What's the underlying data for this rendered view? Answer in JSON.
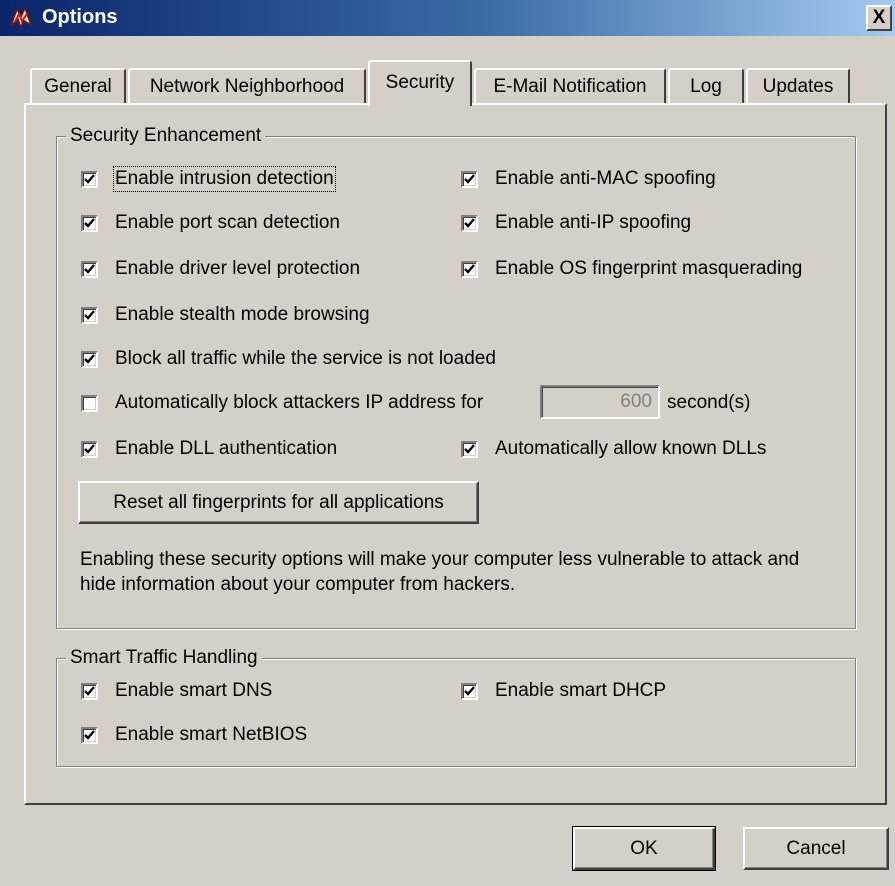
{
  "window": {
    "title": "Options",
    "close_label": "X"
  },
  "tabs": [
    {
      "label": "General"
    },
    {
      "label": "Network Neighborhood"
    },
    {
      "label": "Security",
      "active": true
    },
    {
      "label": "E-Mail Notification"
    },
    {
      "label": "Log"
    },
    {
      "label": "Updates"
    }
  ],
  "security_enhancement": {
    "title": "Security Enhancement",
    "options": [
      {
        "label": "Enable intrusion detection",
        "checked": true
      },
      {
        "label": "Enable anti-MAC spoofing",
        "checked": true
      },
      {
        "label": "Enable port scan detection",
        "checked": true
      },
      {
        "label": "Enable anti-IP spoofing",
        "checked": true
      },
      {
        "label": "Enable driver level protection",
        "checked": true
      },
      {
        "label": "Enable OS fingerprint masquerading",
        "checked": true
      },
      {
        "label": "Enable stealth mode browsing",
        "checked": true
      },
      {
        "label": "Block all traffic while the service is not loaded",
        "checked": true
      },
      {
        "label": "Automatically block attackers IP address for",
        "checked": false
      },
      {
        "label": "Enable DLL authentication",
        "checked": true
      },
      {
        "label": "Automatically allow known DLLs",
        "checked": true
      }
    ],
    "block_seconds": {
      "value": "600",
      "unit": "second(s)"
    },
    "reset_button": "Reset all fingerprints for all applications",
    "description": "Enabling these security options will make your computer less vulnerable to attack and hide information about your computer from hackers."
  },
  "smart_traffic": {
    "title": "Smart Traffic Handling",
    "options": [
      {
        "label": "Enable smart DNS",
        "checked": true
      },
      {
        "label": "Enable smart DHCP",
        "checked": true
      },
      {
        "label": "Enable smart NetBIOS",
        "checked": true
      }
    ]
  },
  "buttons": {
    "ok": "OK",
    "cancel": "Cancel"
  },
  "colors": {
    "face": "#d4d0c8",
    "title_start": "#0a246a",
    "title_end": "#a6caf0"
  }
}
